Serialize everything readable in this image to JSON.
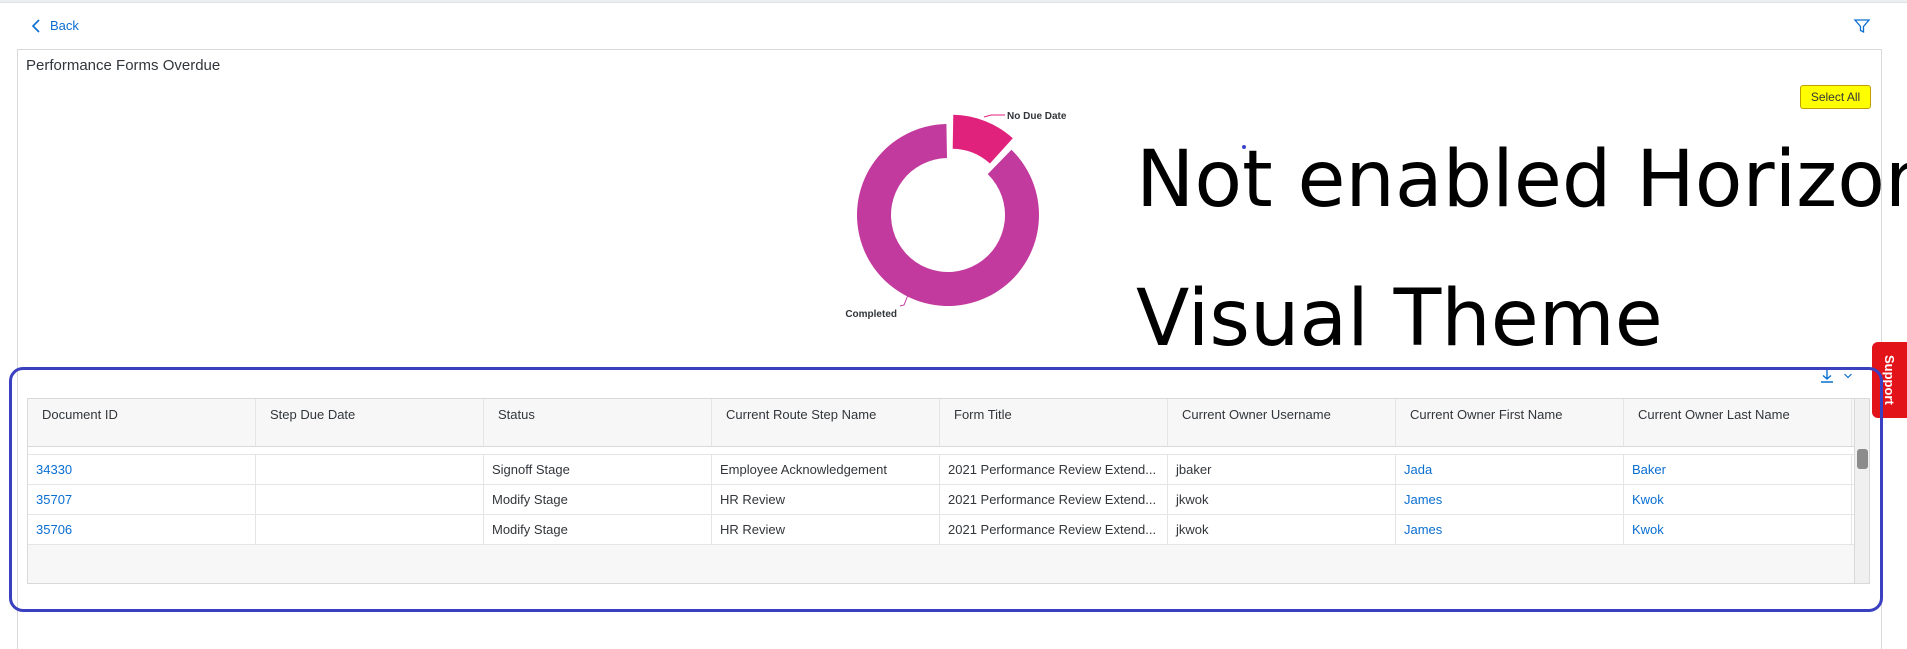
{
  "nav": {
    "back_label": "Back"
  },
  "card": {
    "title": "Performance Forms Overdue",
    "select_all_label": "Select All"
  },
  "chart_data": {
    "type": "pie",
    "categories": [
      "No Due Date",
      "Completed"
    ],
    "values": [
      12,
      88
    ],
    "colors": [
      "#e0227c",
      "#c23a9e"
    ],
    "donut": true
  },
  "overlay": {
    "line1": "Not enabled Horizon",
    "line2": "Visual Theme"
  },
  "support_label": "Support",
  "table": {
    "columns": [
      "Document ID",
      "Step Due Date",
      "Status",
      "Current Route Step Name",
      "Form Title",
      "Current Owner Username",
      "Current Owner First Name",
      "Current Owner Last Name"
    ],
    "rows": [
      {
        "doc_id": "34330",
        "due": "",
        "status": "Signoff Stage",
        "step": "Employee Acknowledgement",
        "form": "2021 Performance Review Extend...",
        "username": "jbaker",
        "first": "Jada",
        "last": "Baker"
      },
      {
        "doc_id": "35707",
        "due": "",
        "status": "Modify Stage",
        "step": "HR Review",
        "form": "2021 Performance Review Extend...",
        "username": "jkwok",
        "first": "James",
        "last": "Kwok"
      },
      {
        "doc_id": "35706",
        "due": "",
        "status": "Modify Stage",
        "step": "HR Review",
        "form": "2021 Performance Review Extend...",
        "username": "jkwok",
        "first": "James",
        "last": "Kwok"
      }
    ]
  }
}
